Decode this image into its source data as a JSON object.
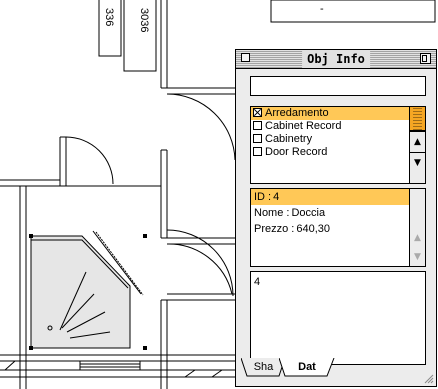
{
  "palette": {
    "title": "Obj Info",
    "name_value": "",
    "class_items": [
      {
        "label": "Arredamento",
        "checked": true,
        "selected": true
      },
      {
        "label": "Cabinet Record",
        "checked": false,
        "selected": false
      },
      {
        "label": "Cabinetry",
        "checked": false,
        "selected": false
      },
      {
        "label": "Door Record",
        "checked": false,
        "selected": false
      }
    ],
    "data_fields": [
      {
        "label": "ID :",
        "value": "4",
        "selected": true
      },
      {
        "label": "Nome :",
        "value": "Doccia",
        "selected": false
      },
      {
        "label": "Prezzo :",
        "value": "640,30",
        "selected": false
      }
    ],
    "text_value": "4",
    "tabs": [
      {
        "label": "Sha",
        "active": false
      },
      {
        "label": "Dat",
        "active": true
      }
    ]
  },
  "plan": {
    "labels": [
      "336",
      "3036"
    ],
    "top_field_text": "-"
  },
  "colors": {
    "selection": "#ffc857",
    "scroll_thumb": "#f5a623",
    "palette_bg": "#ececec",
    "fixture_fill": "#e6e6e6"
  }
}
